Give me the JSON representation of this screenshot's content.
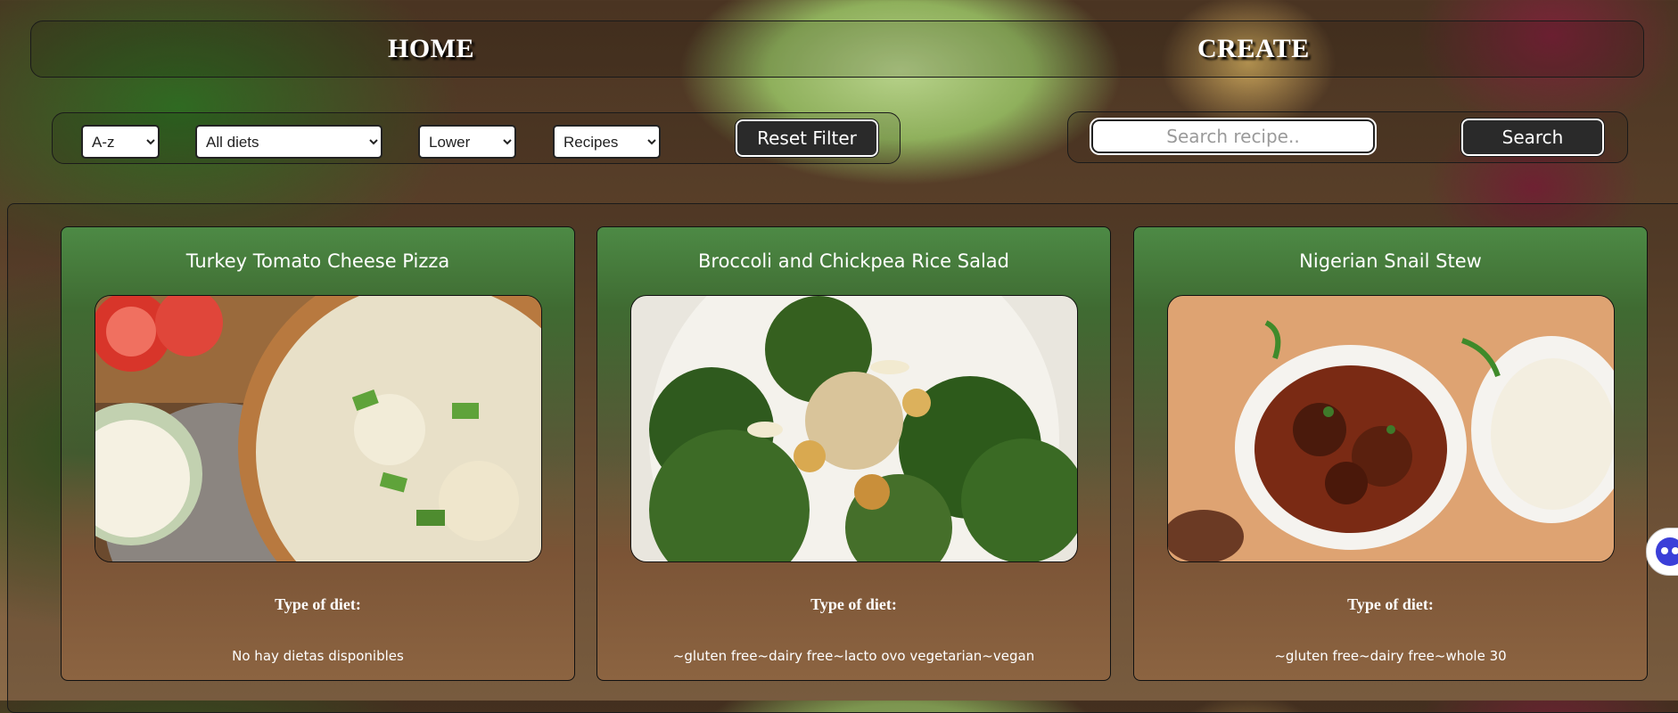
{
  "nav": {
    "home_label": "HOME",
    "create_label": "CREATE"
  },
  "filters": {
    "order": {
      "selected": "A-z",
      "options": [
        "A-z"
      ]
    },
    "diet": {
      "selected": "All diets",
      "options": [
        "All diets"
      ]
    },
    "score": {
      "selected": "Lower",
      "options": [
        "Lower"
      ]
    },
    "source": {
      "selected": "Recipes",
      "options": [
        "Recipes"
      ]
    },
    "reset_label": "Reset Filter"
  },
  "search": {
    "placeholder": "Search recipe..",
    "value": "",
    "button_label": "Search"
  },
  "cards": [
    {
      "title": "Turkey Tomato Cheese Pizza",
      "diet_label": "Type of diet:",
      "diets": "No hay dietas disponibles"
    },
    {
      "title": "Broccoli and Chickpea Rice Salad",
      "diet_label": "Type of diet:",
      "diets": "~gluten free~dairy free~lacto ovo vegetarian~vegan"
    },
    {
      "title": "Nigerian Snail Stew",
      "diet_label": "Type of diet:",
      "diets": "~gluten free~dairy free~whole 30"
    }
  ],
  "colors": {
    "card_top": "#4d8a45",
    "card_bottom": "#8c6441",
    "button_dark": "#2a2a2a"
  }
}
